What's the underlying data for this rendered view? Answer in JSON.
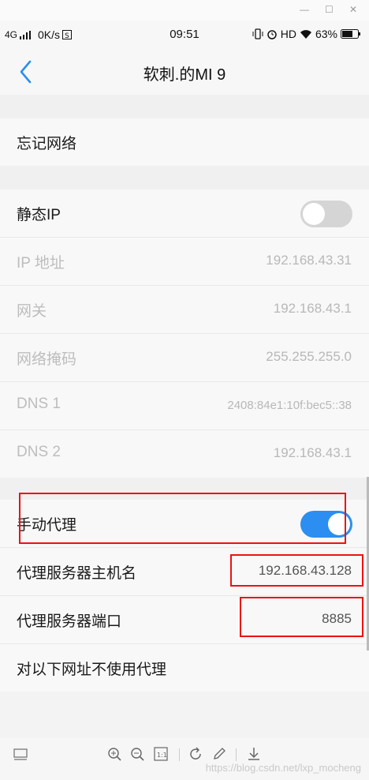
{
  "window": {
    "minimize": "—",
    "maximize": "☐",
    "close": "✕"
  },
  "status_bar": {
    "network": "4G",
    "speed": "0K/s",
    "time": "09:51",
    "hd": "HD",
    "battery": "63%"
  },
  "header": {
    "title": "软刺.的MI 9"
  },
  "forget_network": {
    "label": "忘记网络"
  },
  "static_ip": {
    "label": "静态IP",
    "enabled": false
  },
  "ip_fields": [
    {
      "label": "IP 地址",
      "value": "192.168.43.31"
    },
    {
      "label": "网关",
      "value": "192.168.43.1"
    },
    {
      "label": "网络掩码",
      "value": "255.255.255.0"
    },
    {
      "label": "DNS 1",
      "value": "2408:84e1:10f:bec5::38"
    },
    {
      "label": "DNS 2",
      "value": "192.168.43.1"
    }
  ],
  "proxy": {
    "manual_label": "手动代理",
    "manual_enabled": true,
    "host_label": "代理服务器主机名",
    "host_value": "192.168.43.128",
    "port_label": "代理服务器端口",
    "port_value": "8885",
    "bypass_label": "对以下网址不使用代理"
  },
  "watermark": "https://blog.csdn.net/lxp_mocheng",
  "colors": {
    "accent": "#2b8ef0",
    "highlight": "#ee1111"
  }
}
